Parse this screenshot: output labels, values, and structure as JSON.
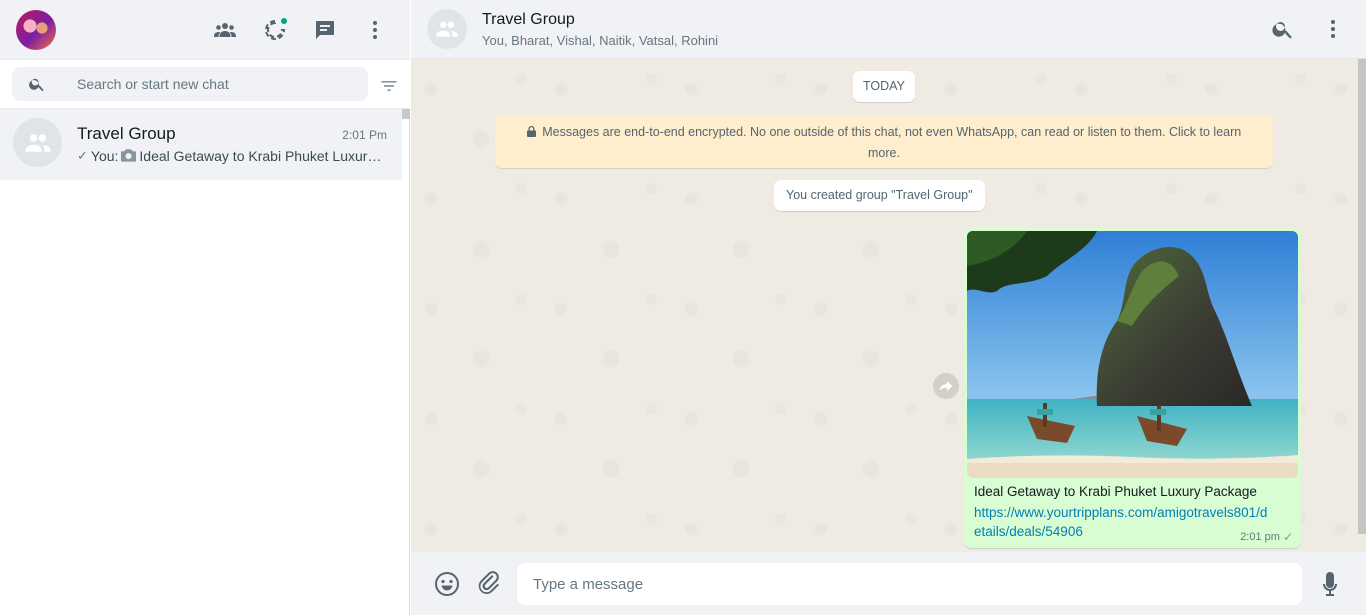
{
  "app": {
    "accent_color": "#00a884",
    "unread_dot_color": "#00a884",
    "link_color": "#027eb5",
    "outgoing_bubble_color": "#d9fdd3"
  },
  "sidebar": {
    "header_icons": [
      "communities-icon",
      "status-icon",
      "new-chat-icon",
      "menu-icon"
    ],
    "search": {
      "placeholder": "Search or start new chat"
    },
    "chats": [
      {
        "name": "Travel Group",
        "time": "2:01 Pm",
        "preview_sender": "You:",
        "preview_text": "Ideal Getaway to Krabi Phuket Luxury Package",
        "preview_media_icon": "camera-icon",
        "status": "sent-single-tick",
        "selected": true
      }
    ]
  },
  "conversation": {
    "title": "Travel Group",
    "members": "You, Bharat, Vishal, Naitik, Vatsal, Rohini",
    "day_label": "TODAY",
    "encryption_notice": "Messages are end-to-end encrypted. No one outside of this chat, not even WhatsApp, can read or listen to them. Click to learn more.",
    "system_message": "You created group \"Travel Group\"",
    "messages": [
      {
        "direction": "outgoing",
        "type": "image",
        "caption": "Ideal Getaway to Krabi Phuket Luxury Package",
        "link": "https://www.yourtripplans.com/amigotravels801/details/deals/54906",
        "time": "2:01 pm",
        "status": "sent-single-tick"
      }
    ]
  },
  "composer": {
    "placeholder": "Type a message"
  }
}
